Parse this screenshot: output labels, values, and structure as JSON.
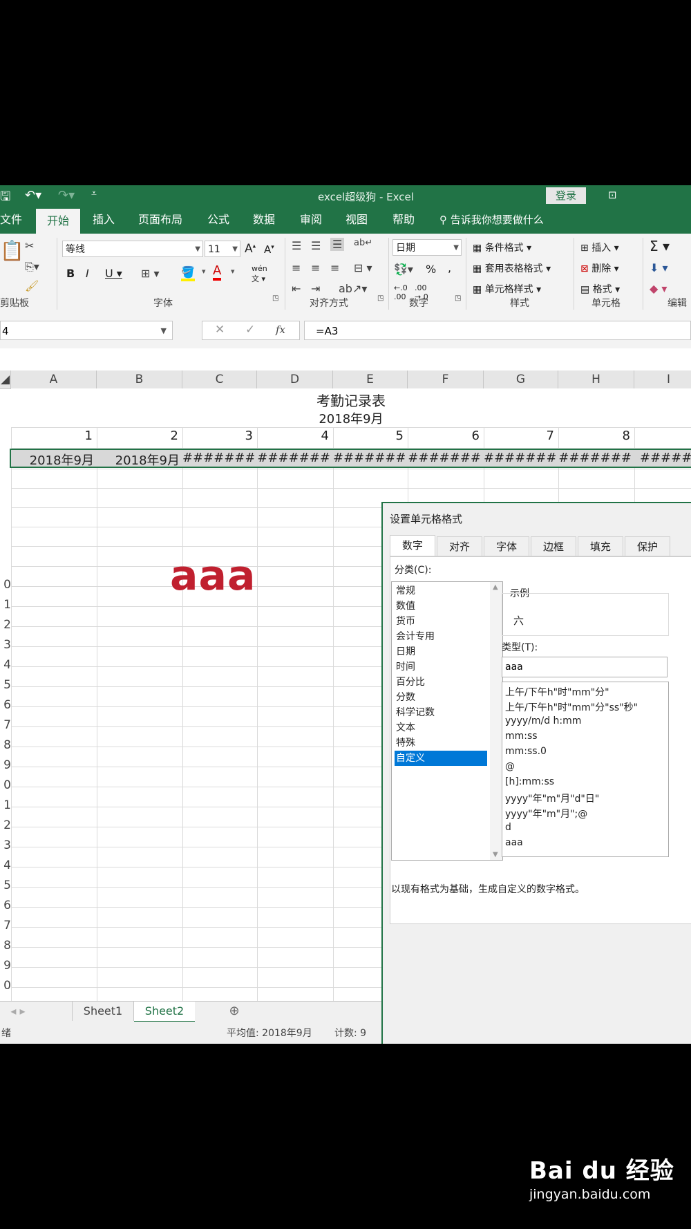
{
  "titlebar": {
    "title": "excel超级狗  -  Excel",
    "login": "登录"
  },
  "tabs": [
    {
      "label": "文件"
    },
    {
      "label": "开始"
    },
    {
      "label": "插入"
    },
    {
      "label": "页面布局"
    },
    {
      "label": "公式"
    },
    {
      "label": "数据"
    },
    {
      "label": "审阅"
    },
    {
      "label": "视图"
    },
    {
      "label": "帮助"
    }
  ],
  "tellme": "告诉我你想要做什么",
  "ribbon": {
    "clipboard": {
      "label": "剪贴板"
    },
    "font": {
      "label": "字体",
      "family": "等线",
      "size": "11",
      "phonetic": "wén"
    },
    "alignment": {
      "label": "对齐方式"
    },
    "number": {
      "label": "数字",
      "format": "日期"
    },
    "styles": {
      "label": "样式",
      "cond": "条件格式",
      "table": "套用表格格式",
      "cell": "单元格样式"
    },
    "cells": {
      "label": "单元格",
      "insert": "插入",
      "delete": "删除",
      "format": "格式"
    },
    "editing": {
      "label": "编辑"
    }
  },
  "formula_bar": {
    "name_box": "4",
    "formula": "=A3"
  },
  "columns": [
    "A",
    "B",
    "C",
    "D",
    "E",
    "F",
    "G",
    "H",
    "I"
  ],
  "row_numbers": [
    "0",
    "1",
    "2",
    "3",
    "4",
    "5",
    "6",
    "7",
    "8",
    "9",
    "0",
    "1",
    "2",
    "3",
    "4",
    "5",
    "6",
    "7",
    "8",
    "9",
    "0"
  ],
  "sheet": {
    "title": "考勤记录表",
    "subtitle": "2018年9月",
    "day_numbers": [
      "1",
      "2",
      "3",
      "4",
      "5",
      "6",
      "7",
      "8"
    ],
    "row4": [
      "2018年9月",
      "2018年9月",
      "#######",
      "#######",
      "#######",
      "#######",
      "#######",
      "#######",
      "#######"
    ],
    "preview": "aaa"
  },
  "sheet_tabs": {
    "sheet1": "Sheet1",
    "sheet2": "Sheet2"
  },
  "status": {
    "ready": "绪",
    "average": "平均值: 2018年9月",
    "count": "计数: 9"
  },
  "dialog": {
    "title": "设置单元格格式",
    "tabs": [
      "数字",
      "对齐",
      "字体",
      "边框",
      "填充",
      "保护"
    ],
    "category_label": "分类(C):",
    "categories": [
      "常规",
      "数值",
      "货币",
      "会计专用",
      "日期",
      "时间",
      "百分比",
      "分数",
      "科学记数",
      "文本",
      "特殊",
      "自定义"
    ],
    "selected_category": "自定义",
    "sample_label": "示例",
    "sample_value": "六",
    "type_label": "类型(T):",
    "type_value": "aaa",
    "formats": [
      "上午/下午h\"时\"mm\"分\"",
      "上午/下午h\"时\"mm\"分\"ss\"秒\"",
      "yyyy/m/d h:mm",
      "mm:ss",
      "mm:ss.0",
      "@",
      "[h]:mm:ss",
      "yyyy\"年\"m\"月\"d\"日\"",
      "yyyy\"年\"m\"月\";@",
      "d",
      "aaa"
    ],
    "note": "以现有格式为基础，生成自定义的数字格式。"
  },
  "watermark": {
    "logo": "Bai du 经验",
    "url": "jingyan.baidu.com"
  }
}
